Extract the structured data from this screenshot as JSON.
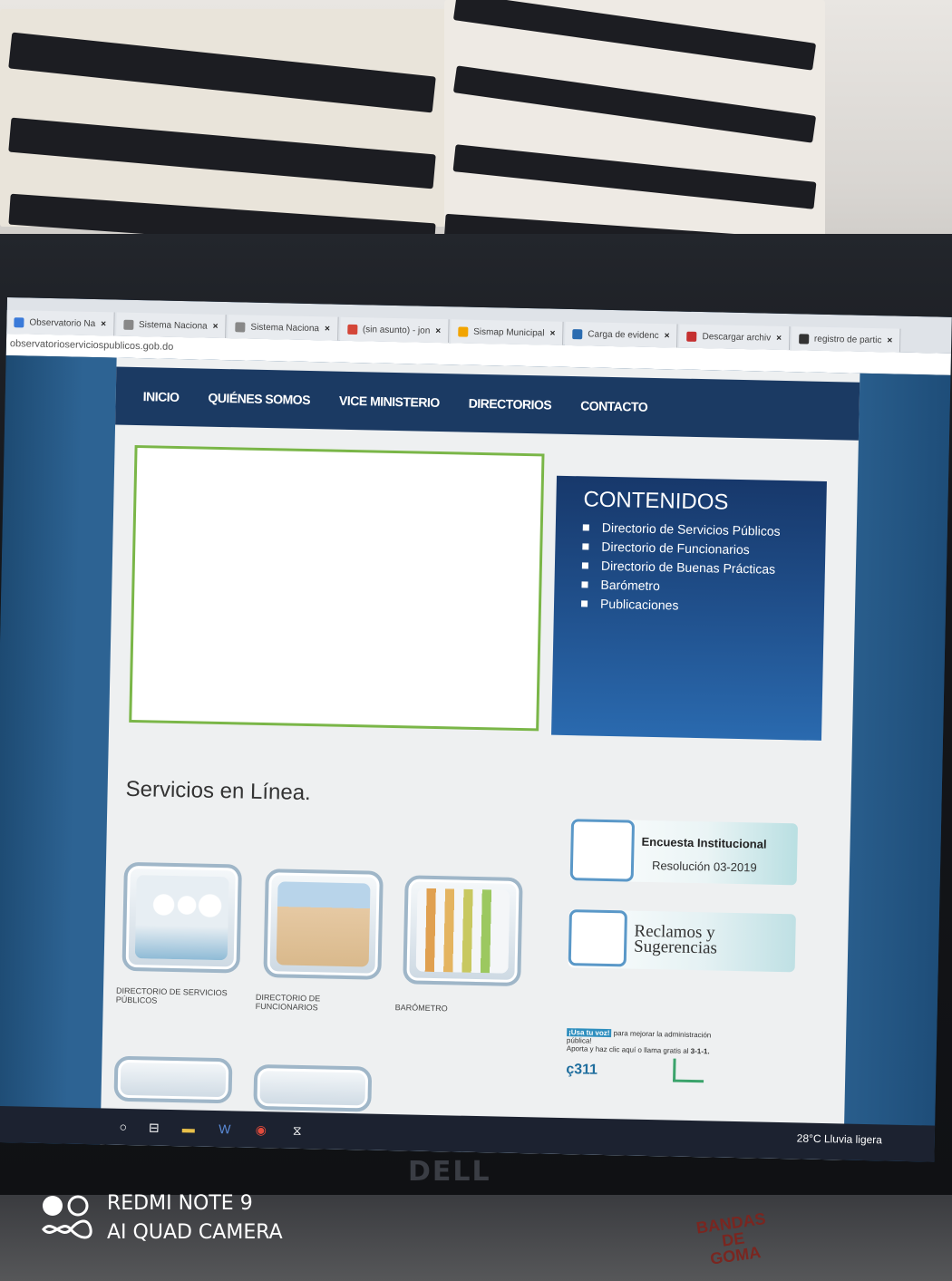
{
  "browser": {
    "tabs": [
      {
        "label": "Observatorio Na",
        "icon_color": "#3a7ad9"
      },
      {
        "label": "Sistema Naciona",
        "icon_color": "#888888"
      },
      {
        "label": "Sistema Naciona",
        "icon_color": "#888888"
      },
      {
        "label": "(sin asunto) - jon",
        "icon_color": "#d44638"
      },
      {
        "label": "Sismap Municipal",
        "icon_color": "#f2a400"
      },
      {
        "label": "Carga de evidenc",
        "icon_color": "#2b6cb0"
      },
      {
        "label": "Descargar archiv",
        "icon_color": "#c53030"
      },
      {
        "label": "registro de partic",
        "icon_color": "#333333"
      }
    ],
    "url": "observatorioserviciospublicos.gob.do"
  },
  "nav": {
    "items": [
      "INICIO",
      "QUIÉNES SOMOS",
      "VICE MINISTERIO",
      "DIRECTORIOS",
      "CONTACTO"
    ]
  },
  "contenidos": {
    "title": "CONTENIDOS",
    "items": [
      "Directorio de Servicios Públicos",
      "Directorio de Funcionarios",
      "Directorio de Buenas Prácticas",
      "Barómetro",
      "Publicaciones"
    ]
  },
  "servicios": {
    "title": "Servicios en Línea.",
    "items": [
      {
        "label": "DIRECTORIO DE SERVICIOS PÚBLICOS",
        "icon": "people-icon"
      },
      {
        "label": "DIRECTORIO DE FUNCIONARIOS",
        "icon": "building-icon"
      },
      {
        "label": "BARÓMETRO",
        "icon": "bar-chart-icon"
      }
    ]
  },
  "encuesta": {
    "title": "Encuesta Institucional",
    "subtitle": "Resolución 03-2019"
  },
  "reclamos": {
    "line1": "Reclamos y",
    "line2": "Sugerencias"
  },
  "usavoz": {
    "tag": "¡Usa tu voz!",
    "text1": "para mejorar la administración pública!",
    "text2": "Aporta y haz clic aquí o llama gratis al",
    "phone": "3-1-1.",
    "logo": "ç311"
  },
  "taskbar": {
    "weather": "28°C  Lluvia ligera",
    "icons": [
      "search-icon",
      "task-view-icon",
      "file-explorer-icon",
      "word-icon",
      "chrome-icon",
      "app-icon"
    ]
  },
  "monitor_brand": "DELL",
  "camera_watermark": {
    "line1": "REDMI NOTE 9",
    "line2": "AI QUAD CAMERA"
  },
  "box_text": {
    "line1": "BANDAS",
    "line2": "DE GOMA"
  }
}
